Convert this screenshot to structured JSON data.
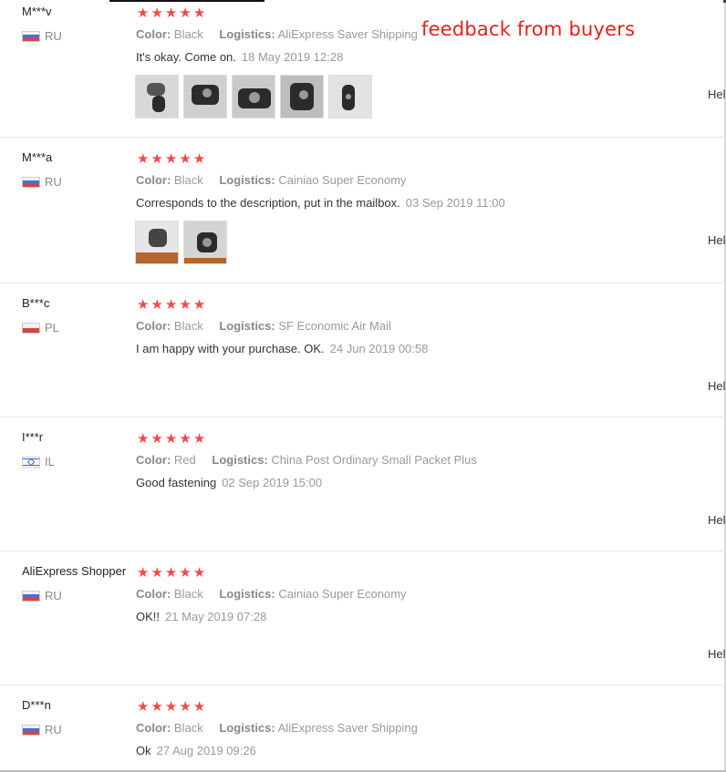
{
  "annotation": "feedback from buyers",
  "labels": {
    "color": "Color:",
    "logistics": "Logistics:",
    "helpful": "Hel"
  },
  "reviews": [
    {
      "user": "M***v",
      "country": "RU",
      "color": "Black",
      "logistics": "AliExpress Saver Shipping",
      "comment": "It's okay. Come on.",
      "date": "18 May 2019 12:28",
      "photo_count": 5
    },
    {
      "user": "M***a",
      "country": "RU",
      "color": "Black",
      "logistics": "Cainiao Super Economy",
      "comment": "Corresponds to the description, put in the mailbox.",
      "date": "03 Sep 2019 11:00",
      "photo_count": 2
    },
    {
      "user": "B***c",
      "country": "PL",
      "color": "Black",
      "logistics": "SF Economic Air Mail",
      "comment": "I am happy with your purchase. OK.",
      "date": "24 Jun 2019 00:58",
      "photo_count": 0
    },
    {
      "user": "I***r",
      "country": "IL",
      "color": "Red",
      "logistics": "China Post Ordinary Small Packet Plus",
      "comment": "Good fastening",
      "date": "02 Sep 2019 15:00",
      "photo_count": 0
    },
    {
      "user": "AliExpress Shopper",
      "country": "RU",
      "color": "Black",
      "logistics": "Cainiao Super Economy",
      "comment": "OK!!",
      "date": "21 May 2019 07:28",
      "photo_count": 0
    },
    {
      "user": "D***n",
      "country": "RU",
      "color": "Black",
      "logistics": "AliExpress Saver Shipping",
      "comment": "Ok",
      "date": "27 Aug 2019 09:26",
      "photo_count": 0
    }
  ],
  "rating_stars": 5,
  "colors": {
    "star": "#f04a4a",
    "annotation": "#e8201c"
  }
}
